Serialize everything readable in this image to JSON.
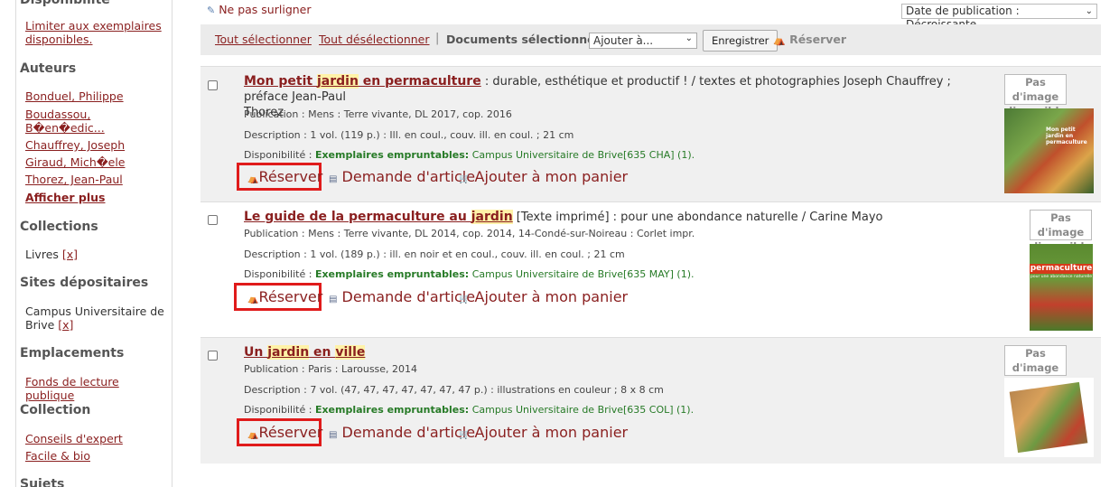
{
  "sidebar": {
    "top_heading": "Disponibilité",
    "limit_link": "Limiter aux exemplaires disponibles.",
    "authors_heading": "Auteurs",
    "authors": [
      "Bonduel, Philippe",
      "Boudassou, B�en�edic...",
      "Chauffrey, Joseph",
      "Giraud, Mich�ele",
      "Thorez, Jean-Paul"
    ],
    "show_more": "Afficher plus",
    "collections_heading": "Collections",
    "collections_item": "Livres",
    "remove_mark": "[x]",
    "sites_heading": "Sites dépositaires",
    "sites_item": "Campus Universitaire de Brive",
    "emplacements_heading": "Emplacements",
    "emplacements_item": "Fonds de lecture publique",
    "collection_heading": "Collection",
    "collection_items": [
      "Conseils d'expert",
      "Facile & bio"
    ],
    "sujets_heading": "Sujets"
  },
  "top": {
    "no_highlight": "Ne pas surligner",
    "sort": "Date de publication : Décroissante"
  },
  "toolbar": {
    "select_all": "Tout sélectionner",
    "deselect_all": "Tout désélectionner",
    "separator": "|",
    "selected_docs": "Documents sélectionnés :",
    "add_to": "Ajouter à...",
    "save": "Enregistrer",
    "reserve": "Réserver"
  },
  "labels": {
    "publication": "Publication :",
    "description": "Description :",
    "availability": "Disponibilité :",
    "available_copies": "Exemplaires empruntables:",
    "reserve": "Réserver",
    "article_request": "Demande d'article",
    "add_to_cart": "Ajouter à mon panier",
    "no_image_1": "Pas d'image",
    "no_image_2": "disponible"
  },
  "results": [
    {
      "title_pre": "Mon petit ",
      "title_hl1": "jardin",
      "title_mid": " en ",
      "title_hl2": "permaculture",
      "title_rest": " : durable, esthétique et productif ! / textes et photographies Joseph Chauffrey ; préface Jean-Paul",
      "title_rest2": "Thorez",
      "publication": "Mens : Terre vivante, DL 2017, cop. 2016",
      "description": "1 vol. (119 p.) : Ill. en coul., couv. ill. en coul. ; 21 cm",
      "availability": "Campus Universitaire de Brive[635 CHA] (1)."
    },
    {
      "title_pre": "Le guide de la permaculture au ",
      "title_hl1": "jardin",
      "title_rest": " [Texte imprimé] : pour une abondance naturelle / Carine Mayo",
      "publication": "Mens : Terre vivante, DL 2014, cop. 2014, 14-Condé-sur-Noireau : Corlet impr.",
      "description": "1 vol. (189 p.) : ill. en noir et en coul., couv. ill. en coul. ; 21 cm",
      "availability": "Campus Universitaire de Brive[635 MAY] (1)."
    },
    {
      "title_pre": "Un ",
      "title_hl1": "jardin",
      "title_mid": " en ",
      "title_hl2": "ville",
      "publication": "Paris : Larousse, 2014",
      "description": "7 vol. (47, 47, 47, 47, 47, 47, 47 p.) : illustrations en couleur ; 8 x 8 cm",
      "availability": "Campus Universitaire de Brive[635 COL] (1)."
    }
  ],
  "covers": {
    "r1_text": "Mon petit jardin en permaculture",
    "r2_text": "permaculture",
    "r2_sub": "pour une abondance naturelle"
  },
  "colors": {
    "link": "#8a1f1f",
    "highlight": "#fff2a8",
    "available": "#267a26",
    "reserve_box": "#e01b1b"
  }
}
